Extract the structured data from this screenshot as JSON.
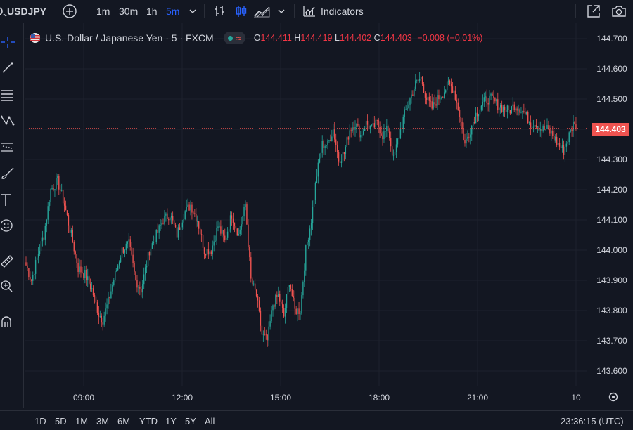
{
  "toolbar": {
    "symbol": "USDJPY",
    "intervals": [
      "1m",
      "30m",
      "1h",
      "5m"
    ],
    "active_interval": "5m",
    "indicators_label": "Indicators"
  },
  "legend": {
    "title": "U.S. Dollar / Japanese Yen · 5 · FXCM",
    "open_label": "O",
    "open": "144.411",
    "high_label": "H",
    "high": "144.419",
    "low_label": "L",
    "low": "144.402",
    "close_label": "C",
    "close": "144.403",
    "change": "−0.008 (−0.01%)"
  },
  "colors": {
    "up": "#26a69a",
    "down": "#ef5350",
    "background": "#131722",
    "grid": "#1e222d",
    "accent": "#2962ff"
  },
  "bottombar": {
    "ranges": [
      "1D",
      "5D",
      "1M",
      "3M",
      "6M",
      "YTD",
      "1Y",
      "5Y",
      "All"
    ],
    "clock": "23:36:15 (UTC)"
  },
  "chart_data": {
    "type": "candlestick",
    "ylim": [
      143.55,
      144.73
    ],
    "y_ticks": [
      "144.700",
      "144.600",
      "144.500",
      "144.400",
      "144.300",
      "144.200",
      "144.100",
      "144.000",
      "143.900",
      "143.800",
      "143.700",
      "143.600"
    ],
    "x_ticks": [
      "09:00",
      "12:00",
      "15:00",
      "18:00",
      "21:00",
      "10"
    ],
    "last_price": "144.403",
    "close_path": [
      [
        0,
        143.95
      ],
      [
        4,
        143.9
      ],
      [
        9,
        143.99
      ],
      [
        13,
        144.05
      ],
      [
        18,
        144.2
      ],
      [
        23,
        144.23
      ],
      [
        28,
        144.15
      ],
      [
        33,
        144.05
      ],
      [
        38,
        143.94
      ],
      [
        43,
        143.92
      ],
      [
        48,
        143.87
      ],
      [
        53,
        143.79
      ],
      [
        56,
        143.77
      ],
      [
        60,
        143.83
      ],
      [
        65,
        143.92
      ],
      [
        70,
        144.0
      ],
      [
        75,
        144.02
      ],
      [
        80,
        143.9
      ],
      [
        84,
        143.87
      ],
      [
        90,
        144.0
      ],
      [
        95,
        144.05
      ],
      [
        100,
        144.1
      ],
      [
        105,
        144.12
      ],
      [
        110,
        144.05
      ],
      [
        115,
        144.12
      ],
      [
        120,
        144.15
      ],
      [
        125,
        144.1
      ],
      [
        130,
        144.0
      ],
      [
        135,
        144.0
      ],
      [
        140,
        144.08
      ],
      [
        145,
        144.03
      ],
      [
        150,
        144.12
      ],
      [
        155,
        144.05
      ],
      [
        160,
        144.15
      ],
      [
        164,
        143.9
      ],
      [
        168,
        143.85
      ],
      [
        172,
        143.72
      ],
      [
        176,
        143.7
      ],
      [
        180,
        143.82
      ],
      [
        184,
        143.85
      ],
      [
        188,
        143.78
      ],
      [
        192,
        143.9
      ],
      [
        196,
        143.8
      ],
      [
        200,
        143.8
      ],
      [
        204,
        144.0
      ],
      [
        208,
        144.1
      ],
      [
        212,
        144.25
      ],
      [
        216,
        144.35
      ],
      [
        220,
        144.35
      ],
      [
        224,
        144.4
      ],
      [
        228,
        144.3
      ],
      [
        232,
        144.32
      ],
      [
        236,
        144.4
      ],
      [
        240,
        144.42
      ],
      [
        244,
        144.38
      ],
      [
        248,
        144.42
      ],
      [
        252,
        144.4
      ],
      [
        256,
        144.42
      ],
      [
        260,
        144.38
      ],
      [
        264,
        144.4
      ],
      [
        268,
        144.3
      ],
      [
        272,
        144.38
      ],
      [
        276,
        144.45
      ],
      [
        280,
        144.5
      ],
      [
        284,
        144.55
      ],
      [
        288,
        144.57
      ],
      [
        292,
        144.5
      ],
      [
        296,
        144.47
      ],
      [
        300,
        144.5
      ],
      [
        304,
        144.52
      ],
      [
        308,
        144.55
      ],
      [
        312,
        144.53
      ],
      [
        316,
        144.45
      ],
      [
        320,
        144.35
      ],
      [
        324,
        144.4
      ],
      [
        328,
        144.45
      ],
      [
        332,
        144.48
      ],
      [
        336,
        144.5
      ],
      [
        340,
        144.5
      ],
      [
        344,
        144.48
      ],
      [
        348,
        144.47
      ],
      [
        352,
        144.46
      ],
      [
        356,
        144.48
      ],
      [
        360,
        144.47
      ],
      [
        364,
        144.45
      ],
      [
        368,
        144.42
      ],
      [
        372,
        144.42
      ],
      [
        376,
        144.4
      ],
      [
        380,
        144.4
      ],
      [
        384,
        144.38
      ],
      [
        388,
        144.35
      ],
      [
        392,
        144.33
      ],
      [
        396,
        144.38
      ],
      [
        400,
        144.43
      ],
      [
        401,
        144.403
      ]
    ]
  }
}
